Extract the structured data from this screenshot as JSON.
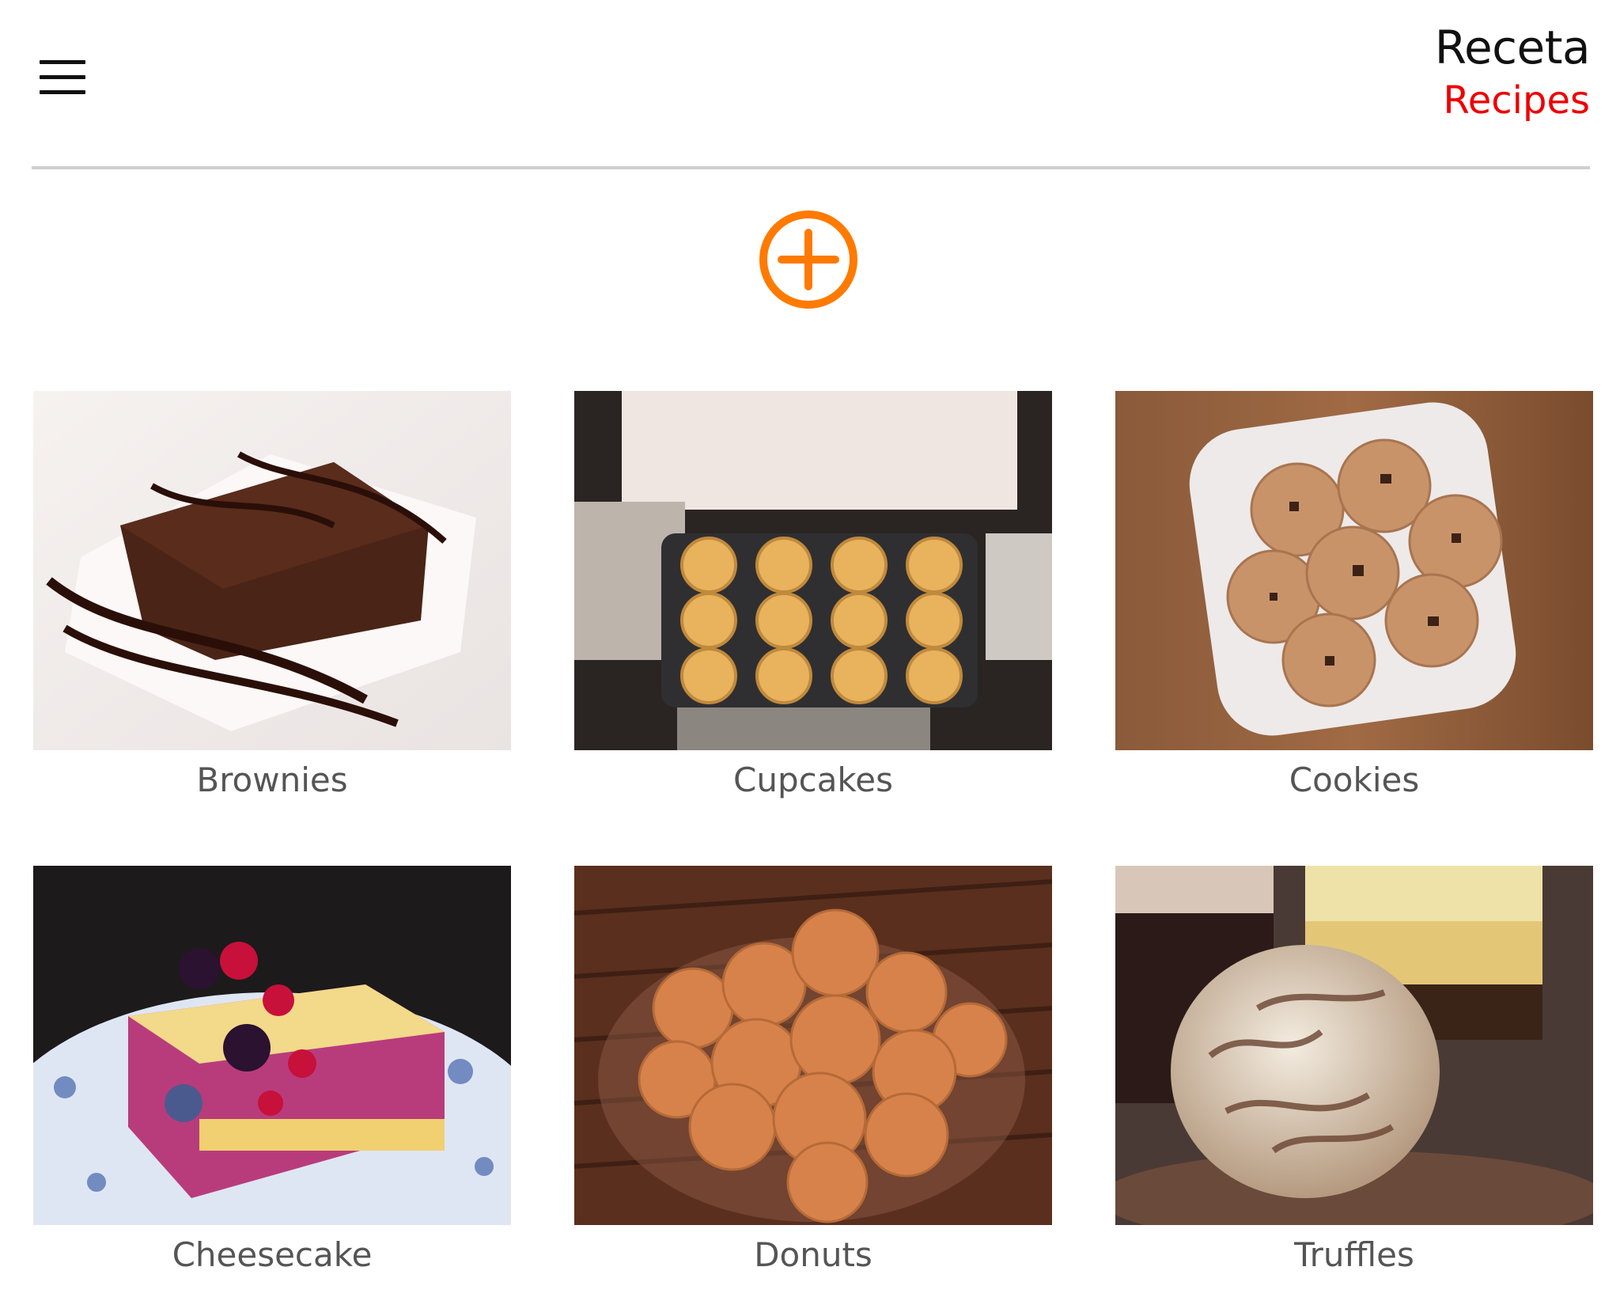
{
  "header": {
    "menu_icon": "hamburger-menu-icon",
    "brand_title": "Receta",
    "brand_subtitle": "Recipes",
    "subtitle_color": "#ee0000"
  },
  "add_button": {
    "icon": "plus-circle-icon",
    "color": "#ff7a00"
  },
  "recipes": [
    {
      "label": "Brownies",
      "image": "brownie slice with chocolate drizzle"
    },
    {
      "label": "Cupcakes",
      "image": "muffin tray of cupcakes"
    },
    {
      "label": "Cookies",
      "image": "plate of chocolate chip cookies"
    },
    {
      "label": "Cheesecake",
      "image": "berry cheesecake bars"
    },
    {
      "label": "Donuts",
      "image": "bowl of sugared donuts"
    },
    {
      "label": "Truffles",
      "image": "chocolate truffle"
    }
  ]
}
